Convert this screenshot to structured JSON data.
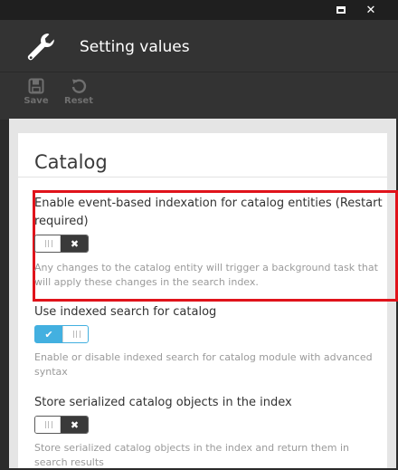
{
  "window": {
    "maximize_icon": "maximize-icon",
    "close_glyph": "✕"
  },
  "header": {
    "title": "Setting values",
    "icon": "wrench-icon"
  },
  "toolbar": {
    "save_label": "Save",
    "reset_label": "Reset"
  },
  "section": {
    "title": "Catalog"
  },
  "settings": [
    {
      "label": "Enable event-based indexation for catalog entities (Restart required)",
      "description": "Any changes to the catalog entity will trigger a background task that will apply these changes in the search index.",
      "enabled": false,
      "state_glyph": "✖"
    },
    {
      "label": "Use indexed search for catalog",
      "description": "Enable or disable indexed search for catalog module with advanced syntax",
      "enabled": true,
      "state_glyph": "✔"
    },
    {
      "label": "Store serialized catalog objects in the index",
      "description": "Store serialized catalog objects in the index and return them in search results",
      "enabled": false,
      "state_glyph": "✖"
    }
  ],
  "colors": {
    "highlight": "#e0131b",
    "toggle_on": "#43b0e0",
    "toggle_off": "#3a3a3a"
  }
}
